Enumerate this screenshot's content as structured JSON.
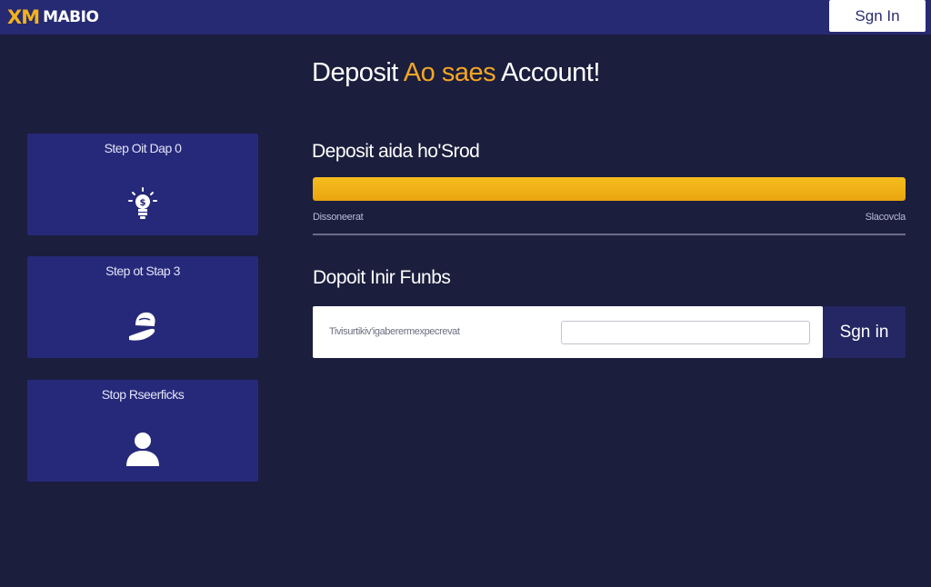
{
  "header": {
    "logo_mark": "XM",
    "logo_word": "MABIO",
    "signin_label": "Sgn In"
  },
  "steps": [
    {
      "label": "Step Oit Dap 0",
      "icon": "lightbulb-icon"
    },
    {
      "label": "Step ot Stap 3",
      "icon": "helmet-hand-icon"
    },
    {
      "label": "Stop Rseerficks",
      "icon": "user-icon"
    }
  ],
  "main": {
    "title_before": "Deposit ",
    "title_accent": "Ao saes",
    "title_after": " Account!",
    "progress_title": "Deposit aida ho'Srod",
    "progress_value": 1.0,
    "progress_left_label": "Dissoneerat",
    "progress_right_label": "Slacovcla",
    "funds_title": "Dopoit Inir Funbs",
    "deposit_hint": "Tivisurtikiv'igaberermexpecrevat",
    "deposit_input_value": "",
    "deposit_input_placeholder": "",
    "deposit_button_label": "Sgn in"
  },
  "colors": {
    "background": "#1b1e3d",
    "header": "#262a73",
    "card": "#26297a",
    "accent": "#f5a623",
    "progress": "#f0b01a"
  }
}
